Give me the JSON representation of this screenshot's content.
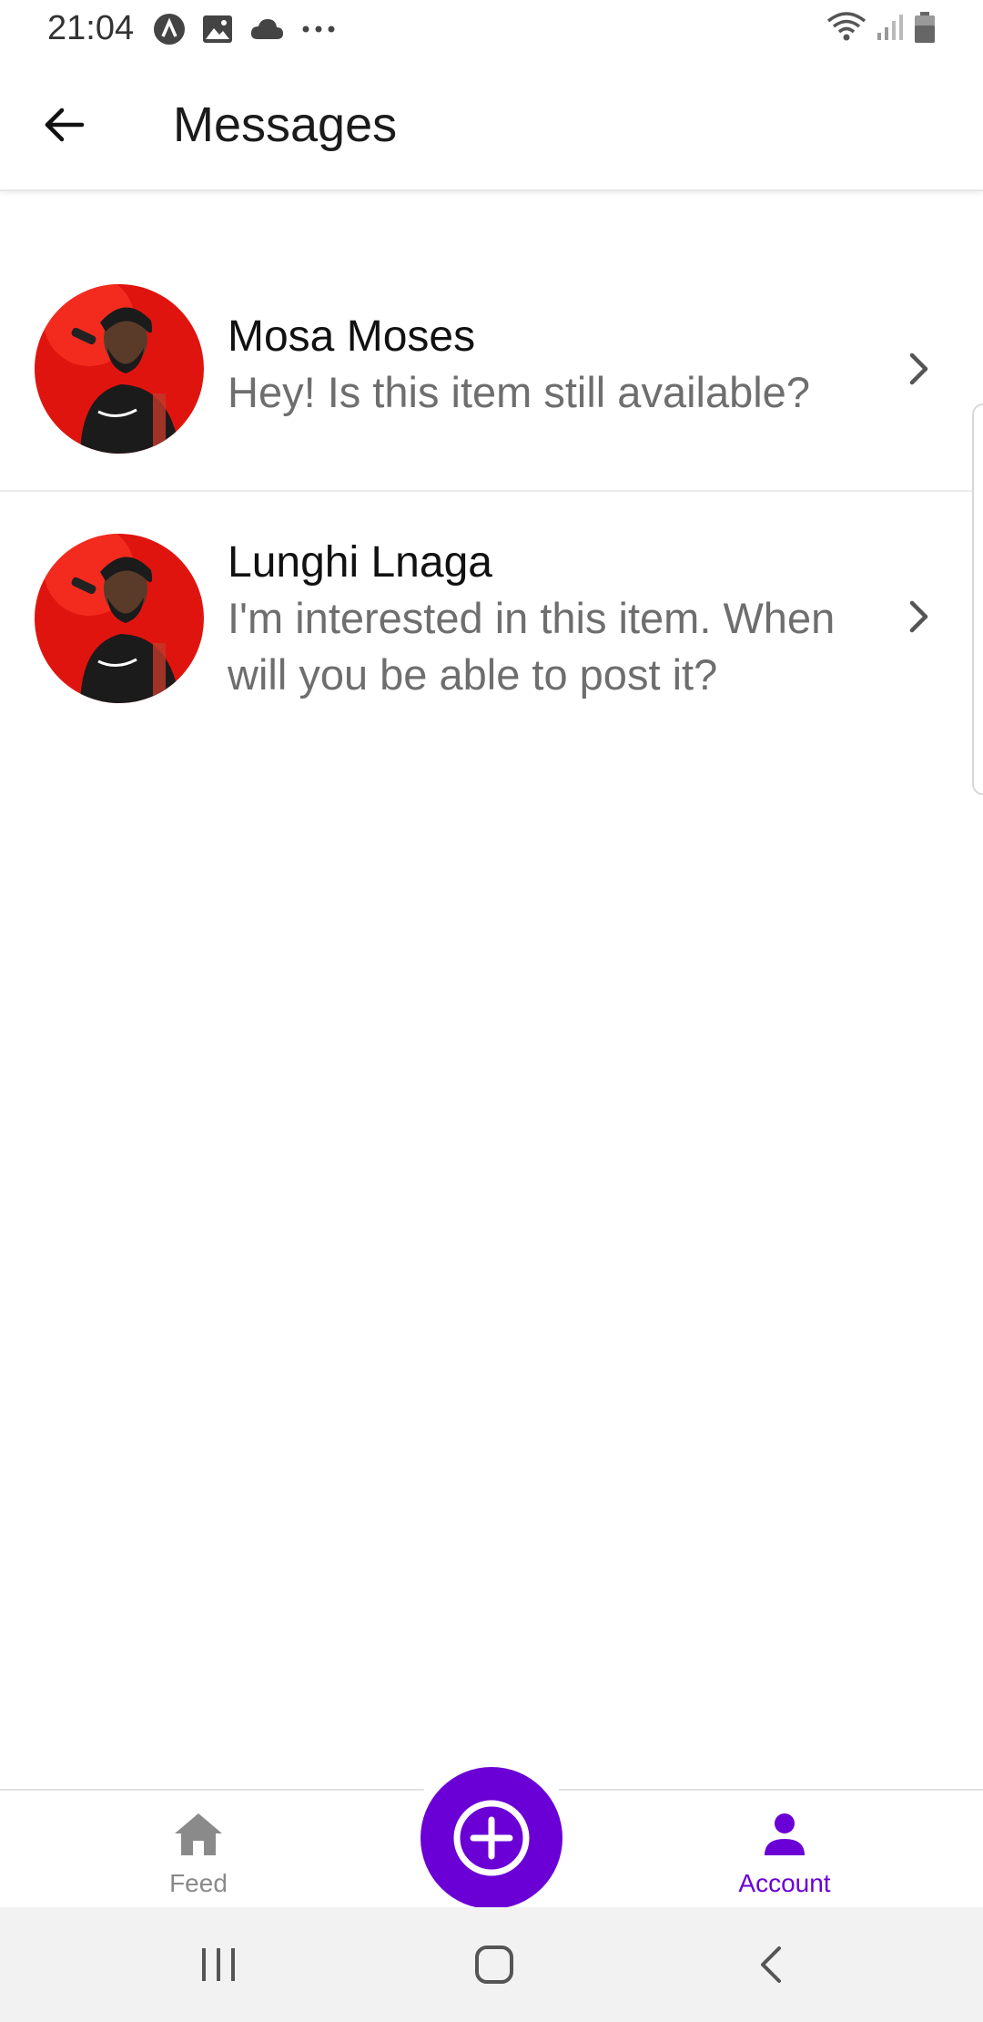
{
  "status_bar": {
    "time": "21:04",
    "left_icons": [
      "app-a-icon",
      "gallery-icon",
      "cloud-icon",
      "more-dots-icon"
    ],
    "right_icons": [
      "wifi-icon",
      "signal-icon",
      "battery-icon"
    ]
  },
  "header": {
    "back_icon": "arrow-left-icon",
    "title": "Messages"
  },
  "messages": [
    {
      "name": "Mosa Moses",
      "preview": "Hey! Is this item still available?",
      "avatar": "avatar-photo",
      "chevron": "chevron-right-icon"
    },
    {
      "name": "Lunghi Lnaga",
      "preview": "I'm interested in this item. When will you be able to post it?",
      "avatar": "avatar-photo",
      "chevron": "chevron-right-icon"
    }
  ],
  "tab_bar": {
    "feed_label": "Feed",
    "account_label": "Account",
    "fab_icon": "plus-circle-icon",
    "active_tab": "Account"
  },
  "colors": {
    "accent": "#6a00d6",
    "inactive_tab": "#8a8a8a",
    "preview_text": "#6e6e6e",
    "avatar_bg": "#e0140f"
  },
  "system_nav": {
    "icons": [
      "recents-icon",
      "home-icon",
      "back-icon"
    ]
  }
}
